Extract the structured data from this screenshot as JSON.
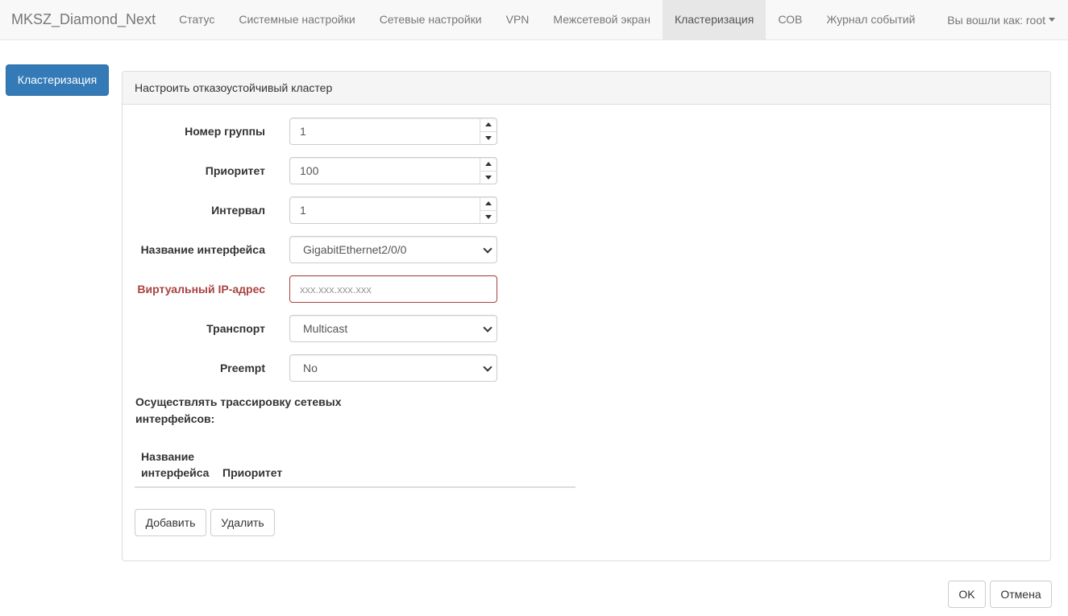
{
  "navbar": {
    "brand": "MKSZ_Diamond_Next",
    "items": [
      {
        "label": "Статус",
        "active": false
      },
      {
        "label": "Системные настройки",
        "active": false
      },
      {
        "label": "Сетевые настройки",
        "active": false
      },
      {
        "label": "VPN",
        "active": false
      },
      {
        "label": "Межсетевой экран",
        "active": false
      },
      {
        "label": "Кластеризация",
        "active": true
      },
      {
        "label": "СОВ",
        "active": false
      },
      {
        "label": "Журнал событий",
        "active": false
      }
    ],
    "user_label": "Вы вошли как: root"
  },
  "sidebar": {
    "button_label": "Кластеризация"
  },
  "panel": {
    "heading": "Настроить отказоустойчивый кластер",
    "fields": {
      "group_number": {
        "label": "Номер группы",
        "value": "1"
      },
      "priority": {
        "label": "Приоритет",
        "value": "100"
      },
      "interval": {
        "label": "Интервал",
        "value": "1"
      },
      "interface_name": {
        "label": "Название интерфейса",
        "value": "GigabitEthernet2/0/0"
      },
      "virtual_ip": {
        "label": "Виртуальный IP-адрес",
        "value": "",
        "placeholder": "xxx.xxx.xxx.xxx"
      },
      "transport": {
        "label": "Транспорт",
        "value": "Multicast"
      },
      "preempt": {
        "label": "Preempt",
        "value": "No"
      }
    },
    "trace": {
      "label": "Осуществлять трассировку сетевых интерфейсов:",
      "columns": {
        "name": "Название интерфейса",
        "priority": "Приоритет"
      }
    },
    "buttons": {
      "add": "Добавить",
      "delete": "Удалить"
    }
  },
  "footer": {
    "ok": "OK",
    "cancel": "Отмена"
  },
  "colors": {
    "primary": "#337ab7",
    "error": "#a94442",
    "navbar_bg": "#f8f8f8"
  }
}
